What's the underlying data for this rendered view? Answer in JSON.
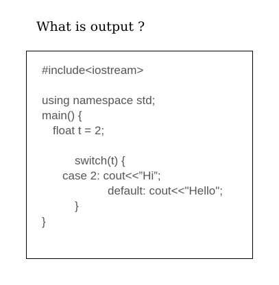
{
  "question": "What is output ?",
  "code": {
    "lines": [
      "#include<iostream>",
      "using namespace std;",
      "main() {",
      "float t = 2;",
      "switch(t) {",
      "case 2: cout<<”Hi”;",
      "default: cout<<\"Hello\";",
      "}",
      "}"
    ]
  }
}
